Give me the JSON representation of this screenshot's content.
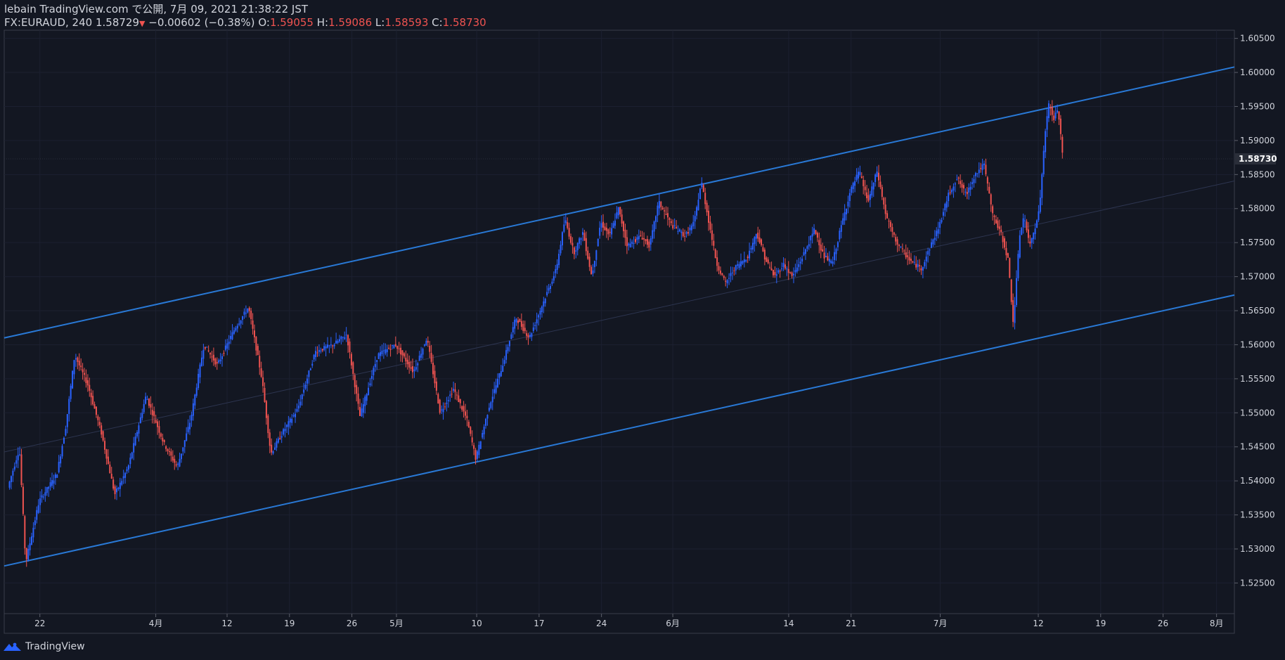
{
  "header": {
    "publish_line": "lebain TradingView.com で公開, 7月 09, 2021 21:38:22 JST",
    "symbol": "FX:EURAUD, 240",
    "last": "1.58729",
    "change": "−0.00602 (−0.38%)",
    "o_label": "O:",
    "o_value": "1.59055",
    "h_label": "H:",
    "h_value": "1.59086",
    "l_label": "L:",
    "l_value": "1.58593",
    "c_label": "C:",
    "c_value": "1.58730"
  },
  "footer": {
    "brand": "TradingView"
  },
  "colors": {
    "background": "#131722",
    "up": "#2962ff",
    "down": "#ef5350",
    "channel": "#2979d6",
    "label_bg": "#2a2e39"
  },
  "chart_data": {
    "type": "candlestick",
    "y_ticks": [
      "1.60500",
      "1.60000",
      "1.59500",
      "1.59000",
      "1.58500",
      "1.58000",
      "1.57500",
      "1.57000",
      "1.56500",
      "1.56000",
      "1.55500",
      "1.55000",
      "1.54500",
      "1.54000",
      "1.53500",
      "1.53000",
      "1.52500"
    ],
    "ylim": [
      1.5205,
      1.6062
    ],
    "x_ticks": [
      {
        "label": "22",
        "t": 2.5
      },
      {
        "label": "4月",
        "t": 15.5
      },
      {
        "label": "12",
        "t": 23.5
      },
      {
        "label": "19",
        "t": 30.5
      },
      {
        "label": "26",
        "t": 37.5
      },
      {
        "label": "5月",
        "t": 42.5
      },
      {
        "label": "10",
        "t": 51.5
      },
      {
        "label": "17",
        "t": 58.5
      },
      {
        "label": "24",
        "t": 65.5
      },
      {
        "label": "6月",
        "t": 73.5
      },
      {
        "label": "14",
        "t": 86.5
      },
      {
        "label": "21",
        "t": 93.5
      },
      {
        "label": "7月",
        "t": 103.5
      },
      {
        "label": "12",
        "t": 114.5
      },
      {
        "label": "19",
        "t": 121.5
      },
      {
        "label": "26",
        "t": 128.5
      },
      {
        "label": "8月",
        "t": 134.5
      }
    ],
    "xlim": [
      -1.5,
      136.5
    ],
    "last_price_label": "1.58730",
    "last_price": 1.5873,
    "channel": {
      "upper": [
        {
          "t": -1.5,
          "p": 1.561
        },
        {
          "t": 136.5,
          "p": 1.6008
        }
      ],
      "lower": [
        {
          "t": -1.5,
          "p": 1.5275
        },
        {
          "t": 136.5,
          "p": 1.5673
        }
      ]
    },
    "price_path": [
      {
        "t": -1.0,
        "p": 1.539
      },
      {
        "t": 0.3,
        "p": 1.5448
      },
      {
        "t": 1.0,
        "p": 1.528
      },
      {
        "t": 2.5,
        "p": 1.537
      },
      {
        "t": 4.5,
        "p": 1.541
      },
      {
        "t": 5.5,
        "p": 1.548
      },
      {
        "t": 6.5,
        "p": 1.5585
      },
      {
        "t": 8.0,
        "p": 1.554
      },
      {
        "t": 9.5,
        "p": 1.547
      },
      {
        "t": 11.0,
        "p": 1.538
      },
      {
        "t": 12.5,
        "p": 1.542
      },
      {
        "t": 14.5,
        "p": 1.5525
      },
      {
        "t": 16.5,
        "p": 1.5455
      },
      {
        "t": 18.0,
        "p": 1.542
      },
      {
        "t": 19.5,
        "p": 1.549
      },
      {
        "t": 21.0,
        "p": 1.56
      },
      {
        "t": 22.5,
        "p": 1.557
      },
      {
        "t": 24.5,
        "p": 1.5625
      },
      {
        "t": 26.0,
        "p": 1.5655
      },
      {
        "t": 27.5,
        "p": 1.555
      },
      {
        "t": 28.5,
        "p": 1.544
      },
      {
        "t": 30.0,
        "p": 1.5475
      },
      {
        "t": 31.5,
        "p": 1.5505
      },
      {
        "t": 33.5,
        "p": 1.559
      },
      {
        "t": 35.5,
        "p": 1.56
      },
      {
        "t": 37.0,
        "p": 1.5615
      },
      {
        "t": 38.5,
        "p": 1.5495
      },
      {
        "t": 40.5,
        "p": 1.5585
      },
      {
        "t": 42.5,
        "p": 1.56
      },
      {
        "t": 44.5,
        "p": 1.556
      },
      {
        "t": 46.0,
        "p": 1.561
      },
      {
        "t": 47.5,
        "p": 1.55
      },
      {
        "t": 49.0,
        "p": 1.5535
      },
      {
        "t": 50.5,
        "p": 1.549
      },
      {
        "t": 51.5,
        "p": 1.5432
      },
      {
        "t": 53.0,
        "p": 1.551
      },
      {
        "t": 54.5,
        "p": 1.557
      },
      {
        "t": 56.0,
        "p": 1.564
      },
      {
        "t": 57.5,
        "p": 1.561
      },
      {
        "t": 59.0,
        "p": 1.566
      },
      {
        "t": 60.5,
        "p": 1.571
      },
      {
        "t": 61.5,
        "p": 1.5785
      },
      {
        "t": 62.5,
        "p": 1.5735
      },
      {
        "t": 63.5,
        "p": 1.5765
      },
      {
        "t": 64.5,
        "p": 1.57
      },
      {
        "t": 65.5,
        "p": 1.578
      },
      {
        "t": 66.5,
        "p": 1.576
      },
      {
        "t": 67.5,
        "p": 1.58
      },
      {
        "t": 68.5,
        "p": 1.5745
      },
      {
        "t": 70.0,
        "p": 1.576
      },
      {
        "t": 71.0,
        "p": 1.5745
      },
      {
        "t": 72.0,
        "p": 1.581
      },
      {
        "t": 73.5,
        "p": 1.5775
      },
      {
        "t": 75.0,
        "p": 1.576
      },
      {
        "t": 76.0,
        "p": 1.578
      },
      {
        "t": 76.8,
        "p": 1.584
      },
      {
        "t": 77.5,
        "p": 1.579
      },
      {
        "t": 78.5,
        "p": 1.572
      },
      {
        "t": 79.5,
        "p": 1.569
      },
      {
        "t": 80.5,
        "p": 1.5712
      },
      {
        "t": 82.0,
        "p": 1.573
      },
      {
        "t": 83.0,
        "p": 1.5765
      },
      {
        "t": 84.0,
        "p": 1.5725
      },
      {
        "t": 85.0,
        "p": 1.57
      },
      {
        "t": 86.0,
        "p": 1.5718
      },
      {
        "t": 87.0,
        "p": 1.57
      },
      {
        "t": 88.0,
        "p": 1.5725
      },
      {
        "t": 89.5,
        "p": 1.577
      },
      {
        "t": 90.5,
        "p": 1.573
      },
      {
        "t": 91.5,
        "p": 1.572
      },
      {
        "t": 92.5,
        "p": 1.5775
      },
      {
        "t": 93.5,
        "p": 1.5825
      },
      {
        "t": 94.5,
        "p": 1.5855
      },
      {
        "t": 95.5,
        "p": 1.581
      },
      {
        "t": 96.5,
        "p": 1.5855
      },
      {
        "t": 97.5,
        "p": 1.579
      },
      {
        "t": 98.5,
        "p": 1.5755
      },
      {
        "t": 99.5,
        "p": 1.5735
      },
      {
        "t": 100.5,
        "p": 1.572
      },
      {
        "t": 101.5,
        "p": 1.5712
      },
      {
        "t": 102.5,
        "p": 1.5745
      },
      {
        "t": 103.5,
        "p": 1.5775
      },
      {
        "t": 104.5,
        "p": 1.582
      },
      {
        "t": 105.5,
        "p": 1.5845
      },
      {
        "t": 106.5,
        "p": 1.582
      },
      {
        "t": 107.5,
        "p": 1.585
      },
      {
        "t": 108.5,
        "p": 1.5865
      },
      {
        "t": 109.5,
        "p": 1.579
      },
      {
        "t": 110.5,
        "p": 1.576
      },
      {
        "t": 111.2,
        "p": 1.5725
      },
      {
        "t": 111.8,
        "p": 1.563
      },
      {
        "t": 112.5,
        "p": 1.576
      },
      {
        "t": 113.0,
        "p": 1.579
      },
      {
        "t": 113.6,
        "p": 1.5745
      },
      {
        "t": 114.2,
        "p": 1.577
      },
      {
        "t": 114.8,
        "p": 1.581
      },
      {
        "t": 115.3,
        "p": 1.5905
      },
      {
        "t": 115.8,
        "p": 1.5955
      },
      {
        "t": 116.3,
        "p": 1.593
      },
      {
        "t": 116.8,
        "p": 1.5948
      },
      {
        "t": 117.3,
        "p": 1.588
      }
    ]
  }
}
